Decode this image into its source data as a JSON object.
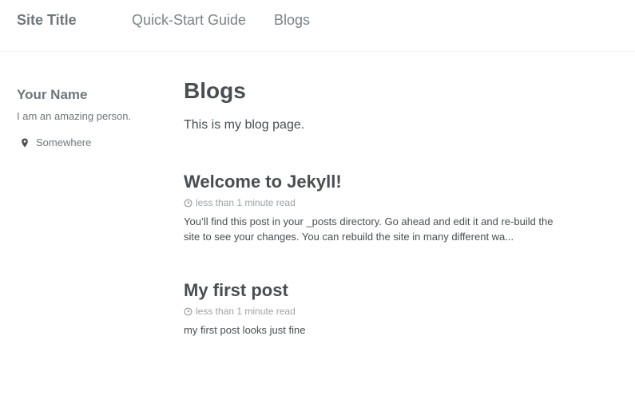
{
  "header": {
    "site_title": "Site Title",
    "nav": [
      "Quick-Start Guide",
      "Blogs"
    ]
  },
  "sidebar": {
    "author_name": "Your Name",
    "bio": "I am an amazing person.",
    "location": "Somewhere",
    "location_icon": "map-marker-icon"
  },
  "main": {
    "title": "Blogs",
    "intro": "This is my blog page.",
    "posts": [
      {
        "title": "Welcome to Jekyll!",
        "read_time": "less than 1 minute read",
        "excerpt": "You’ll find this post in your _posts directory. Go ahead and edit it and re-build the site to see your changes. You can rebuild the site in many different wa..."
      },
      {
        "title": "My first post",
        "read_time": "less than 1 minute read",
        "excerpt": "my first post looks just fine"
      }
    ],
    "meta_icon": "clock-icon"
  },
  "colors": {
    "text": "#494e52",
    "muted": "#6f777d",
    "meta": "#9da2a6",
    "border": "#f2f3f3"
  }
}
